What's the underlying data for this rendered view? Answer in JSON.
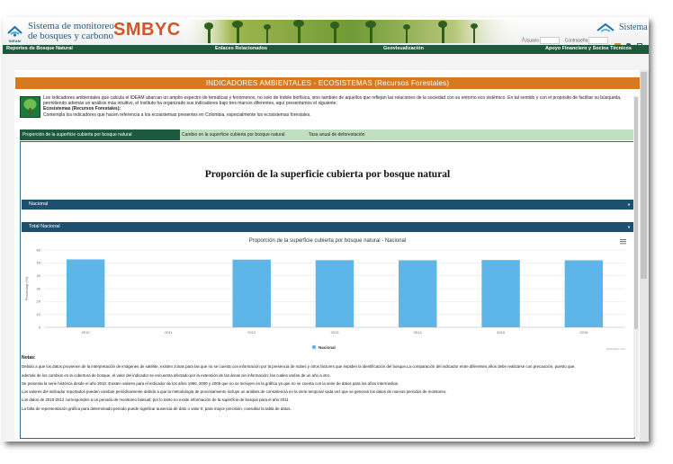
{
  "header": {
    "logo_label": "IDEAM",
    "title_line1": "Sistema de monitoreo",
    "title_line2": "de bosques y carbono",
    "brand": "SMBYC",
    "right_title": "Sistema d",
    "login": {
      "user_label": "Usuario",
      "password_label": "Contraseña"
    }
  },
  "nav": {
    "items": [
      "Reportes de Bosque Natural",
      "Enlaces Relacionados",
      "Geovisualización",
      "Apoyo Financiero y Socios Técnicos"
    ]
  },
  "page": {
    "title": "INDICADORES AMBIENTALES - ECOSISTEMAS (Recursos Forestales)",
    "intro": "Los indicadores ambientales que calcula el IDEAM abarcan un amplio espectro de temáticas y fenómenos, no solo de índole biofísica, sino también de aquellos que reflejan las relaciones de la sociedad con su entorno eco sistémico. En tal sentido y con el propósito de facilitar su búsqueda, permitiendo además un análisis más intuitivo, el Instituto ha organizado sus indicadores bajo tres marcos diferentes, aquí presentamos el siguiente:",
    "ecosystem_heading": "Ecosistemas (Recursos Forestales):",
    "ecosystem_text": "Contempla los indicadores que hacen referencia a los ecosistemas presentes en Colombia, especialmente los ecosistemas forestales."
  },
  "tabs": [
    "Proporción de la superficie cubierta por bosque natural",
    "Cambio en la superficie cubierta por bosque natural",
    "Tasa anual de deforestación"
  ],
  "panel": {
    "title": "Proporción de la superficie cubierta por bosque natural",
    "dropdown1": "Nacional",
    "dropdown2": "Total Nacional"
  },
  "chart_data": {
    "type": "bar",
    "title": "Proporción de la superficie cubierta por bosque natural - Nacional",
    "ylabel": "Porcentaje (%)",
    "xlabel": "",
    "ylim": [
      0,
      60
    ],
    "yticks": [
      0,
      10,
      20,
      30,
      40,
      50,
      60
    ],
    "categories": [
      "2010",
      "2011",
      "2012",
      "2013",
      "2014",
      "2015",
      "2016"
    ],
    "series": [
      {
        "name": "Nacional",
        "values": [
          52.7,
          null,
          52.5,
          52.1,
          52.0,
          52.2,
          52.0
        ]
      }
    ],
    "credit": "Highcharts.com",
    "colors": {
      "bar": "#5eb5e8"
    }
  },
  "notes": {
    "heading": "Notas:",
    "lines": [
      "Debido a que los datos provienen de la interpretación de imágenes de satélite, existen zonas para las que no se cuenta con información por la presencia de nubes y otros factores que impiden la identificación del bosque.La comparación del indicador entre diferentes años debe realizarse con precaución, puesto que,",
      "además de los cambios en la cobertura de bosque, el valor del indicador se encuentra afectado por la extensión de las áreas sin información; las cuales varían de un año a otro.",
      "Se presenta la serie histórica desde el año 2010. Existen valores para el indicador de los años 1990, 2000 y 2005 que no se incluyen en la gráfica ya que no se cuenta con la serie de datos para los años intermedios.",
      "Los valores del indicador reportados pueden cambiar periódicamente debido a que la metodología de procesamiento incluye un análisis de consistencia en la serie temporal cada vez que se generan los datos de nuevos periodos de monitoreo.",
      "Los datos de 2010-2012 corresponden a un periodo de monitoreo bianual; por lo tanto no existe información de la superficie de bosque para el año 2011",
      "La falta de representación gráfica para determinado periodo puede significar ausencia de dato o valor 0, para mayor precisión, consultar la tabla de datos."
    ]
  }
}
